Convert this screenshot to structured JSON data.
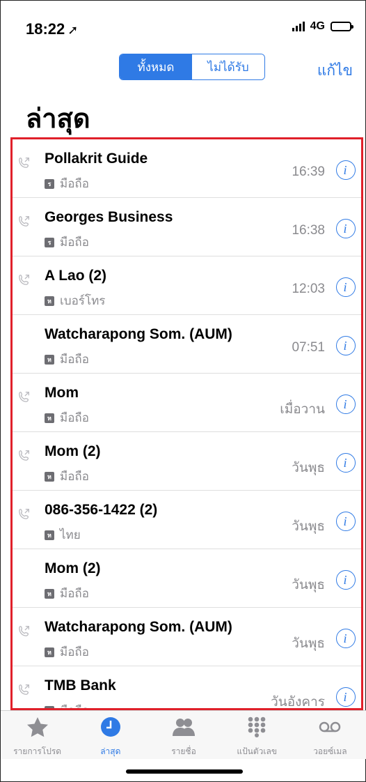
{
  "status_bar": {
    "time": "18:22",
    "network": "4G"
  },
  "nav": {
    "segment_all": "ทั้งหมด",
    "segment_missed": "ไม่ได้รับ",
    "edit_label": "แก้ไข"
  },
  "page_title": "ล่าสุด",
  "calls": [
    {
      "name": "Pollakrit Guide",
      "badge": "ร",
      "type": "มือถือ",
      "time": "16:39",
      "outgoing_icon": true
    },
    {
      "name": "Georges Business",
      "badge": "ร",
      "type": "มือถือ",
      "time": "16:38",
      "outgoing_icon": true
    },
    {
      "name": "A Lao (2)",
      "badge": "ห",
      "type": "เบอร์โทร",
      "time": "12:03",
      "outgoing_icon": true
    },
    {
      "name": "Watcharapong Som. (AUM)",
      "badge": "ห",
      "type": "มือถือ",
      "time": "07:51",
      "outgoing_icon": false
    },
    {
      "name": "Mom",
      "badge": "ห",
      "type": "มือถือ",
      "time": "เมื่อวาน",
      "outgoing_icon": true
    },
    {
      "name": "Mom (2)",
      "badge": "ห",
      "type": "มือถือ",
      "time": "วันพุธ",
      "outgoing_icon": true
    },
    {
      "name": "086-356-1422 (2)",
      "badge": "ห",
      "type": "ไทย",
      "time": "วันพุธ",
      "outgoing_icon": true
    },
    {
      "name": "Mom (2)",
      "badge": "ห",
      "type": "มือถือ",
      "time": "วันพุธ",
      "outgoing_icon": false
    },
    {
      "name": "Watcharapong Som. (AUM)",
      "badge": "ห",
      "type": "มือถือ",
      "time": "วันพุธ",
      "outgoing_icon": true
    },
    {
      "name": "TMB Bank",
      "badge": "ห",
      "type": "มือถือ",
      "time": "วันอังคาร",
      "outgoing_icon": true
    }
  ],
  "tabs": [
    {
      "label": "รายการโปรด",
      "icon": "star-icon",
      "active": false
    },
    {
      "label": "ล่าสุด",
      "icon": "clock-icon",
      "active": true
    },
    {
      "label": "รายชื่อ",
      "icon": "contacts-icon",
      "active": false
    },
    {
      "label": "แป้นตัวเลข",
      "icon": "keypad-icon",
      "active": false
    },
    {
      "label": "วอยซ์เมล",
      "icon": "voicemail-icon",
      "active": false
    }
  ],
  "colors": {
    "accent": "#2f7ae5",
    "highlight_border": "#e0202a",
    "secondary_text": "#8a8a8e"
  }
}
